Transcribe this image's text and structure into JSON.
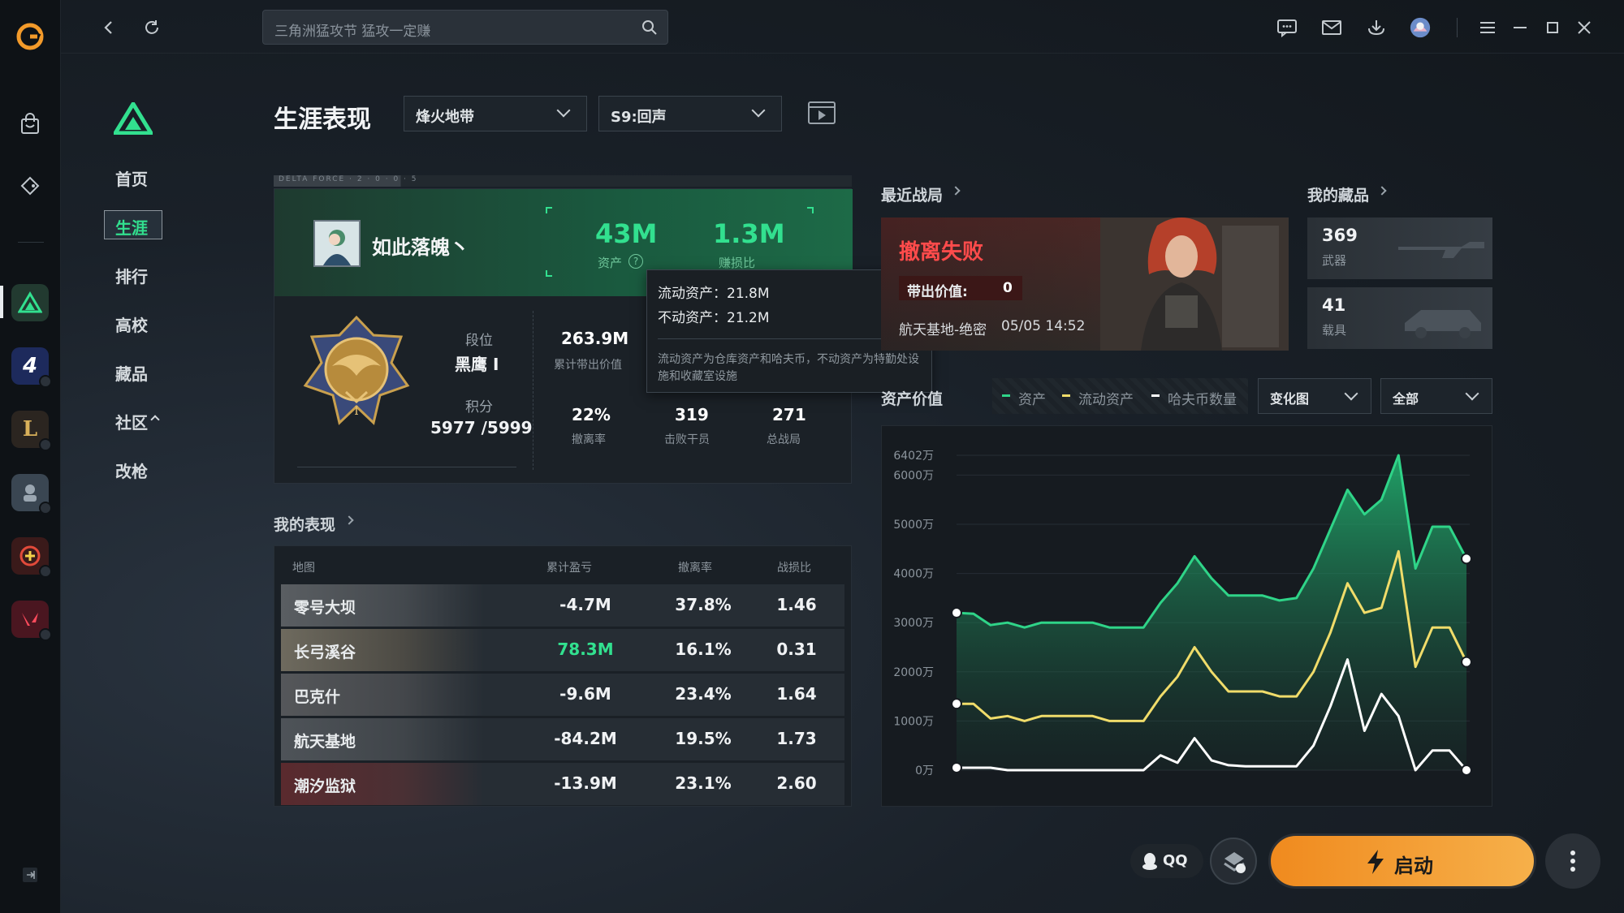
{
  "topbar": {
    "search_placeholder": "三角洲猛攻节  猛攻一定赚"
  },
  "nav": {
    "items": [
      "首页",
      "生涯",
      "排行",
      "高校",
      "藏品",
      "社区",
      "改枪"
    ],
    "active": "生涯"
  },
  "header": {
    "title": "生涯表现",
    "mode_dropdown": "烽火地带",
    "season_dropdown": "S9:回声"
  },
  "profile": {
    "tag": "DELTA FORCE · 2 · 0 · 0 · 5",
    "player_name": "如此落魄丶",
    "assets_value": "43M",
    "assets_label": "资产",
    "kd_value": "1.3M",
    "kd_label": "赚损比",
    "rank_label": "段位",
    "rank_value": "黑鹰 I",
    "score_label": "积分",
    "score_value": "5977 /5999",
    "stats": [
      {
        "value": "263.9M",
        "label": "累计带出价值"
      },
      {
        "value": "22%",
        "label": "撤离率"
      },
      {
        "value": "319",
        "label": "击败干员"
      },
      {
        "value": "271",
        "label": "总战局"
      }
    ]
  },
  "tooltip": {
    "line1": "流动资产：21.8M",
    "line2": "不动资产：21.2M",
    "note": "流动资产为仓库资产和哈夫币，不动资产为特勤处设施和收藏室设施"
  },
  "performance": {
    "title": "我的表现",
    "headers": [
      "地图",
      "累计盈亏",
      "撤离率",
      "战损比"
    ],
    "rows": [
      {
        "map": "零号大坝",
        "pnl": "-4.7M",
        "rate": "37.8%",
        "kd": "1.46",
        "positive": false
      },
      {
        "map": "长弓溪谷",
        "pnl": "78.3M",
        "rate": "16.1%",
        "kd": "0.31",
        "positive": true
      },
      {
        "map": "巴克什",
        "pnl": "-9.6M",
        "rate": "23.4%",
        "kd": "1.64",
        "positive": false
      },
      {
        "map": "航天基地",
        "pnl": "-84.2M",
        "rate": "19.5%",
        "kd": "1.73",
        "positive": false
      },
      {
        "map": "潮汐监狱",
        "pnl": "-13.9M",
        "rate": "23.1%",
        "kd": "2.60",
        "positive": false
      }
    ]
  },
  "recent": {
    "title": "最近战局",
    "result": "撤离失败",
    "value_label": "带出价值:",
    "value": "0",
    "map": "航天基地-绝密",
    "time": "05/05 14:52"
  },
  "collection": {
    "title": "我的藏品",
    "items": [
      {
        "count": "369",
        "label": "武器"
      },
      {
        "count": "41",
        "label": "载具"
      }
    ]
  },
  "asset_chart": {
    "title": "资产价值",
    "legend": [
      "资产",
      "流动资产",
      "哈夫币数量"
    ],
    "view_dropdown": "变化图",
    "filter_dropdown": "全部"
  },
  "chart_data": {
    "type": "area",
    "ylabel": "",
    "yticks": [
      "6402万",
      "6000万",
      "5000万",
      "4000万",
      "3000万",
      "2000万",
      "1000万",
      "0万"
    ],
    "ylim": [
      0,
      6402
    ],
    "x": [
      0,
      1,
      2,
      3,
      4,
      5,
      6,
      7,
      8,
      9,
      10,
      11,
      12,
      13,
      14,
      15,
      16,
      17,
      18,
      19,
      20,
      21,
      22,
      23,
      24,
      25,
      26,
      27,
      28,
      29,
      30
    ],
    "series": [
      {
        "name": "资产",
        "color": "#2fd488",
        "values": [
          3200,
          3180,
          2950,
          3000,
          2900,
          3000,
          3000,
          3000,
          3000,
          2900,
          2900,
          2900,
          3400,
          3800,
          4350,
          3900,
          3550,
          3550,
          3550,
          3450,
          3500,
          4100,
          4900,
          5700,
          5200,
          5500,
          6402,
          4100,
          4950,
          4950,
          4300
        ]
      },
      {
        "name": "流动资产",
        "color": "#f0dc6a",
        "values": [
          1350,
          1350,
          1050,
          1100,
          1000,
          1100,
          1100,
          1100,
          1100,
          1000,
          1000,
          1000,
          1500,
          1900,
          2500,
          2000,
          1600,
          1600,
          1600,
          1500,
          1500,
          2000,
          2800,
          3800,
          3200,
          3300,
          4450,
          2100,
          2900,
          2900,
          2200
        ]
      },
      {
        "name": "哈夫币数量",
        "color": "#ffffff",
        "values": [
          50,
          50,
          50,
          0,
          0,
          0,
          0,
          0,
          0,
          0,
          0,
          0,
          300,
          150,
          650,
          200,
          100,
          80,
          80,
          80,
          80,
          500,
          1300,
          2250,
          800,
          1550,
          1100,
          0,
          400,
          400,
          -50
        ]
      }
    ]
  },
  "launch": {
    "qq_label": "QQ",
    "launch_label": "启动"
  }
}
